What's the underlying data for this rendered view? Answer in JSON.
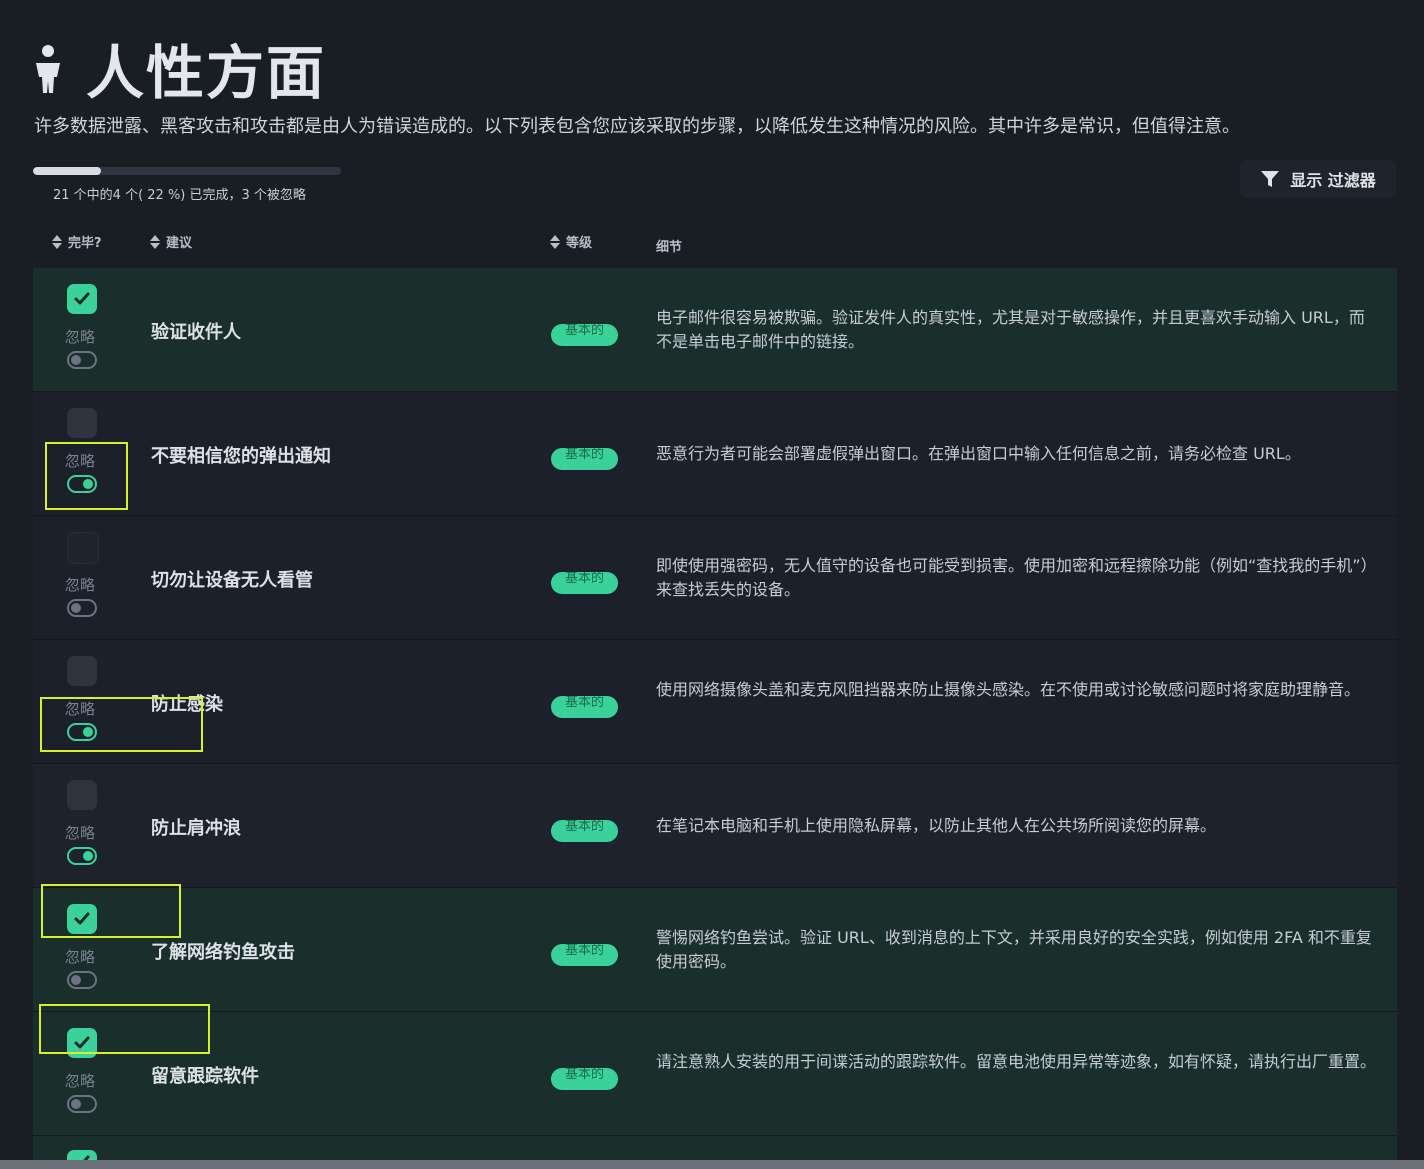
{
  "header": {
    "title": "人性方面",
    "icon": "person-icon"
  },
  "intro": "许多数据泄露、黑客攻击和攻击都是由人为错误造成的。以下列表包含您应该采取的步骤，以降低发生这种情况的风险。其中许多是常识，但值得注意。",
  "progress": {
    "fraction": 0.22,
    "text": "21 个中的4 个( 22 %) 已完成，3 个被忽略"
  },
  "filter": {
    "label": "显示 过滤器",
    "icon": "filter-icon"
  },
  "columns": {
    "done": "完毕?",
    "advice": "建议",
    "level": "等级",
    "details": "细节"
  },
  "ignore_label": "忽略",
  "rows": [
    {
      "title": "验证收件人",
      "level": "基本的",
      "details": "电子邮件很容易被欺骗。验证发件人的真实性，尤其是对于敏感操作，并且更喜欢手动输入 URL，而不是单击电子邮件中的链接。",
      "done": true,
      "ignored": false
    },
    {
      "title": "不要相信您的弹出通知",
      "level": "基本的",
      "details": "恶意行为者可能会部署虚假弹出窗口。在弹出窗口中输入任何信息之前，请务必检查 URL。",
      "done": false,
      "ignored": true
    },
    {
      "title": "切勿让设备无人看管",
      "level": "基本的",
      "details": "即使使用强密码，无人值守的设备也可能受到损害。使用加密和远程擦除功能（例如“查找我的手机”）来查找丢失的设备。",
      "done": false,
      "ignored": false
    },
    {
      "title": "防止感染",
      "level": "基本的",
      "details": "使用网络摄像头盖和麦克风阻挡器来防止摄像头感染。在不使用或讨论敏感问题时将家庭助理静音。",
      "done": false,
      "ignored": true
    },
    {
      "title": "防止肩冲浪",
      "level": "基本的",
      "details": "在笔记本电脑和手机上使用隐私屏幕，以防止其他人在公共场所阅读您的屏幕。",
      "done": false,
      "ignored": true
    },
    {
      "title": "了解网络钓鱼攻击",
      "level": "基本的",
      "details": "警惕网络钓鱼尝试。验证 URL、收到消息的上下文，并采用良好的安全实践，例如使用 2FA 和不重复使用密码。",
      "done": true,
      "ignored": false
    },
    {
      "title": "留意跟踪软件",
      "level": "基本的",
      "details": "请注意熟人安装的用于间谍活动的跟踪软件。留意电池使用异常等迹象，如有怀疑，请执行出厂重置。",
      "done": true,
      "ignored": false
    }
  ],
  "colors": {
    "accent": "#3ad29a",
    "highlight": "#d6ef2f",
    "background": "#191d24"
  }
}
